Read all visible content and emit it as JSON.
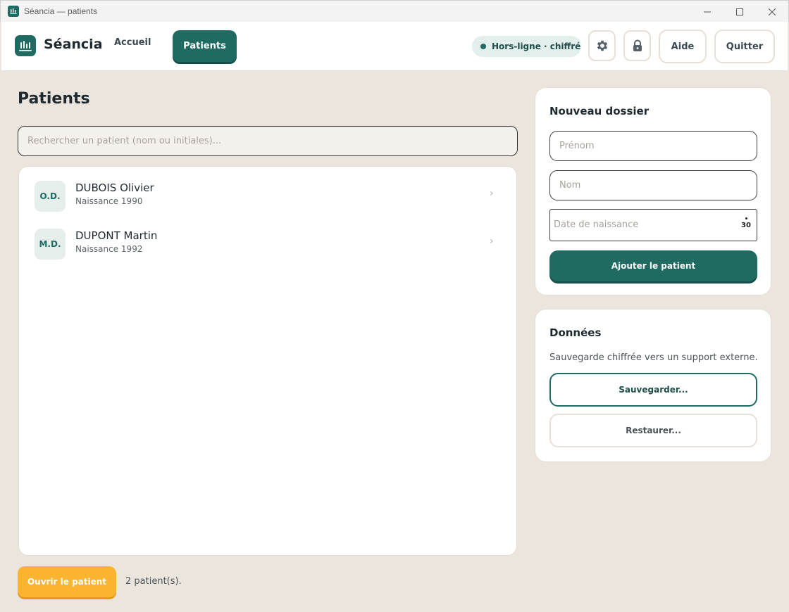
{
  "window": {
    "title": "Séancia — patients",
    "icon": "app-logo-icon",
    "controls": [
      "minimize-icon",
      "maximize-icon",
      "close-icon"
    ]
  },
  "header": {
    "brand": "Séancia",
    "nav": {
      "home": "Accueil",
      "patients": "Patients"
    },
    "status": "Hors-ligne · chiffré",
    "icons": [
      "gear-icon",
      "lock-icon"
    ],
    "help": "Aide",
    "quit": "Quitter"
  },
  "main": {
    "title": "Patients",
    "search_placeholder": "Rechercher un patient (nom ou initiales)...",
    "patients": [
      {
        "initials": "O.D.",
        "name": "DUBOIS Olivier",
        "birth": "Naissance 1990"
      },
      {
        "initials": "M.D.",
        "name": "DUPONT Martin",
        "birth": "Naissance 1992"
      }
    ],
    "open_button": "Ouvrir le patient",
    "count": "2 patient(s)."
  },
  "new_record": {
    "title": "Nouveau dossier",
    "first_name_placeholder": "Prénom",
    "last_name_placeholder": "Nom",
    "birthdate_placeholder": "Date de naissance",
    "calendar_day": "30",
    "add_button": "Ajouter le patient"
  },
  "data_panel": {
    "title": "Données",
    "description": "Sauvegarde chiffrée vers un support externe.",
    "save_button": "Sauvegarder...",
    "restore_button": "Restaurer..."
  },
  "colors": {
    "accent": "#1f6b62",
    "warning": "#fbb330",
    "background": "#ebe5dd"
  }
}
